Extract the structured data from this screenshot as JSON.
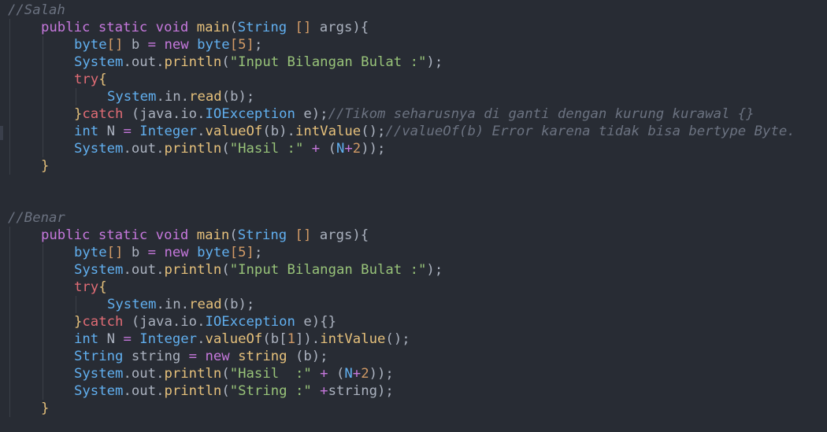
{
  "editor": {
    "theme_colors": {
      "background": "#282c34",
      "keyword": "#c678dd",
      "type": "#61afef",
      "function": "#e5c07b",
      "string": "#98c379",
      "number": "#d19a66",
      "plain": "#abb2bf",
      "comment": "#6b7280",
      "control": "#e06c75"
    },
    "lines": [
      {
        "tokens": [
          {
            "t": "//Salah",
            "c": "comment"
          }
        ]
      },
      {
        "indent": 1,
        "tokens": [
          {
            "t": "public static void ",
            "c": "keyword"
          },
          {
            "t": "main",
            "c": "function"
          },
          {
            "t": "(",
            "c": "punct"
          },
          {
            "t": "String",
            "c": "type"
          },
          {
            "t": " [] ",
            "c": "number"
          },
          {
            "t": "args",
            "c": "plain"
          },
          {
            "t": "){",
            "c": "punct"
          }
        ]
      },
      {
        "indent": 2,
        "tokens": [
          {
            "t": "byte",
            "c": "type"
          },
          {
            "t": "[]",
            "c": "number"
          },
          {
            "t": " b ",
            "c": "plain"
          },
          {
            "t": "=",
            "c": "operator"
          },
          {
            "t": " ",
            "c": "plain"
          },
          {
            "t": "new",
            "c": "keyword"
          },
          {
            "t": " ",
            "c": "plain"
          },
          {
            "t": "byte",
            "c": "type"
          },
          {
            "t": "[5]",
            "c": "number"
          },
          {
            "t": ";",
            "c": "punct"
          }
        ]
      },
      {
        "indent": 2,
        "tokens": [
          {
            "t": "System",
            "c": "type"
          },
          {
            "t": ".",
            "c": "punct"
          },
          {
            "t": "out",
            "c": "plain"
          },
          {
            "t": ".",
            "c": "punct"
          },
          {
            "t": "println",
            "c": "function"
          },
          {
            "t": "(",
            "c": "punct"
          },
          {
            "t": "\"Input Bilangan Bulat :\"",
            "c": "string"
          },
          {
            "t": ");",
            "c": "punct"
          }
        ]
      },
      {
        "indent": 2,
        "tokens": [
          {
            "t": "try",
            "c": "control"
          },
          {
            "t": "{",
            "c": "brace"
          }
        ]
      },
      {
        "indent": 3,
        "tokens": [
          {
            "t": "System",
            "c": "type"
          },
          {
            "t": ".",
            "c": "punct"
          },
          {
            "t": "in",
            "c": "plain"
          },
          {
            "t": ".",
            "c": "punct"
          },
          {
            "t": "read",
            "c": "function"
          },
          {
            "t": "(b);",
            "c": "punct"
          }
        ]
      },
      {
        "indent": 2,
        "tokens": [
          {
            "t": "}",
            "c": "brace"
          },
          {
            "t": "catch",
            "c": "control"
          },
          {
            "t": " (",
            "c": "punct"
          },
          {
            "t": "java",
            "c": "plain"
          },
          {
            "t": ".",
            "c": "punct"
          },
          {
            "t": "io",
            "c": "plain"
          },
          {
            "t": ".",
            "c": "punct"
          },
          {
            "t": "IOException",
            "c": "type"
          },
          {
            "t": " e);",
            "c": "punct"
          },
          {
            "t": "//Tikom seharusnya di ganti dengan kurung kurawal {}",
            "c": "comment"
          }
        ]
      },
      {
        "indent": 2,
        "tokens": [
          {
            "t": "int",
            "c": "type"
          },
          {
            "t": " N ",
            "c": "plain"
          },
          {
            "t": "=",
            "c": "operator"
          },
          {
            "t": " ",
            "c": "plain"
          },
          {
            "t": "Integer",
            "c": "type"
          },
          {
            "t": ".",
            "c": "punct"
          },
          {
            "t": "valueOf",
            "c": "function"
          },
          {
            "t": "(b).",
            "c": "punct"
          },
          {
            "t": "intValue",
            "c": "function"
          },
          {
            "t": "();",
            "c": "punct"
          },
          {
            "t": "//valueOf(b) Error karena tidak bisa bertype Byte.",
            "c": "comment"
          }
        ]
      },
      {
        "indent": 2,
        "tokens": [
          {
            "t": "System",
            "c": "type"
          },
          {
            "t": ".",
            "c": "punct"
          },
          {
            "t": "out",
            "c": "plain"
          },
          {
            "t": ".",
            "c": "punct"
          },
          {
            "t": "println",
            "c": "function"
          },
          {
            "t": "(",
            "c": "punct"
          },
          {
            "t": "\"Hasil :\"",
            "c": "string"
          },
          {
            "t": " ",
            "c": "plain"
          },
          {
            "t": "+",
            "c": "operator"
          },
          {
            "t": " (",
            "c": "punct"
          },
          {
            "t": "N",
            "c": "type"
          },
          {
            "t": "+",
            "c": "operator"
          },
          {
            "t": "2",
            "c": "number"
          },
          {
            "t": "));",
            "c": "punct"
          }
        ]
      },
      {
        "indent": 1,
        "tokens": [
          {
            "t": "}",
            "c": "brace"
          }
        ]
      },
      {
        "tokens": []
      },
      {
        "tokens": []
      },
      {
        "tokens": [
          {
            "t": "//Benar",
            "c": "comment"
          }
        ]
      },
      {
        "indent": 1,
        "tokens": [
          {
            "t": "public static void ",
            "c": "keyword"
          },
          {
            "t": "main",
            "c": "function"
          },
          {
            "t": "(",
            "c": "punct"
          },
          {
            "t": "String",
            "c": "type"
          },
          {
            "t": " [] ",
            "c": "number"
          },
          {
            "t": "args",
            "c": "plain"
          },
          {
            "t": "){",
            "c": "punct"
          }
        ]
      },
      {
        "indent": 2,
        "tokens": [
          {
            "t": "byte",
            "c": "type"
          },
          {
            "t": "[]",
            "c": "number"
          },
          {
            "t": " b ",
            "c": "plain"
          },
          {
            "t": "=",
            "c": "operator"
          },
          {
            "t": " ",
            "c": "plain"
          },
          {
            "t": "new",
            "c": "keyword"
          },
          {
            "t": " ",
            "c": "plain"
          },
          {
            "t": "byte",
            "c": "type"
          },
          {
            "t": "[5]",
            "c": "number"
          },
          {
            "t": ";",
            "c": "punct"
          }
        ]
      },
      {
        "indent": 2,
        "tokens": [
          {
            "t": "System",
            "c": "type"
          },
          {
            "t": ".",
            "c": "punct"
          },
          {
            "t": "out",
            "c": "plain"
          },
          {
            "t": ".",
            "c": "punct"
          },
          {
            "t": "println",
            "c": "function"
          },
          {
            "t": "(",
            "c": "punct"
          },
          {
            "t": "\"Input Bilangan Bulat :\"",
            "c": "string"
          },
          {
            "t": ");",
            "c": "punct"
          }
        ]
      },
      {
        "indent": 2,
        "tokens": [
          {
            "t": "try",
            "c": "control"
          },
          {
            "t": "{",
            "c": "brace"
          }
        ]
      },
      {
        "indent": 3,
        "tokens": [
          {
            "t": "System",
            "c": "type"
          },
          {
            "t": ".",
            "c": "punct"
          },
          {
            "t": "in",
            "c": "plain"
          },
          {
            "t": ".",
            "c": "punct"
          },
          {
            "t": "read",
            "c": "function"
          },
          {
            "t": "(b);",
            "c": "punct"
          }
        ]
      },
      {
        "indent": 2,
        "tokens": [
          {
            "t": "}",
            "c": "brace"
          },
          {
            "t": "catch",
            "c": "control"
          },
          {
            "t": " (",
            "c": "punct"
          },
          {
            "t": "java",
            "c": "plain"
          },
          {
            "t": ".",
            "c": "punct"
          },
          {
            "t": "io",
            "c": "plain"
          },
          {
            "t": ".",
            "c": "punct"
          },
          {
            "t": "IOException",
            "c": "type"
          },
          {
            "t": " e){}",
            "c": "punct"
          }
        ]
      },
      {
        "indent": 2,
        "tokens": [
          {
            "t": "int",
            "c": "type"
          },
          {
            "t": " N ",
            "c": "plain"
          },
          {
            "t": "=",
            "c": "operator"
          },
          {
            "t": " ",
            "c": "plain"
          },
          {
            "t": "Integer",
            "c": "type"
          },
          {
            "t": ".",
            "c": "punct"
          },
          {
            "t": "valueOf",
            "c": "function"
          },
          {
            "t": "(b[",
            "c": "punct"
          },
          {
            "t": "1",
            "c": "number"
          },
          {
            "t": "]).",
            "c": "punct"
          },
          {
            "t": "intValue",
            "c": "function"
          },
          {
            "t": "();",
            "c": "punct"
          }
        ]
      },
      {
        "indent": 2,
        "tokens": [
          {
            "t": "String",
            "c": "type"
          },
          {
            "t": " string ",
            "c": "plain"
          },
          {
            "t": "=",
            "c": "operator"
          },
          {
            "t": " ",
            "c": "plain"
          },
          {
            "t": "new",
            "c": "keyword"
          },
          {
            "t": " ",
            "c": "plain"
          },
          {
            "t": "string",
            "c": "function"
          },
          {
            "t": " (b);",
            "c": "punct"
          }
        ]
      },
      {
        "indent": 2,
        "tokens": [
          {
            "t": "System",
            "c": "type"
          },
          {
            "t": ".",
            "c": "punct"
          },
          {
            "t": "out",
            "c": "plain"
          },
          {
            "t": ".",
            "c": "punct"
          },
          {
            "t": "println",
            "c": "function"
          },
          {
            "t": "(",
            "c": "punct"
          },
          {
            "t": "\"Hasil  :\"",
            "c": "string"
          },
          {
            "t": " ",
            "c": "plain"
          },
          {
            "t": "+",
            "c": "operator"
          },
          {
            "t": " (",
            "c": "punct"
          },
          {
            "t": "N",
            "c": "type"
          },
          {
            "t": "+",
            "c": "operator"
          },
          {
            "t": "2",
            "c": "number"
          },
          {
            "t": "));",
            "c": "punct"
          }
        ]
      },
      {
        "indent": 2,
        "tokens": [
          {
            "t": "System",
            "c": "type"
          },
          {
            "t": ".",
            "c": "punct"
          },
          {
            "t": "out",
            "c": "plain"
          },
          {
            "t": ".",
            "c": "punct"
          },
          {
            "t": "println",
            "c": "function"
          },
          {
            "t": "(",
            "c": "punct"
          },
          {
            "t": "\"String :\"",
            "c": "string"
          },
          {
            "t": " ",
            "c": "plain"
          },
          {
            "t": "+",
            "c": "operator"
          },
          {
            "t": "string",
            "c": "plain"
          },
          {
            "t": ");",
            "c": "punct"
          }
        ]
      },
      {
        "indent": 1,
        "tokens": [
          {
            "t": "}",
            "c": "brace"
          }
        ]
      }
    ]
  }
}
